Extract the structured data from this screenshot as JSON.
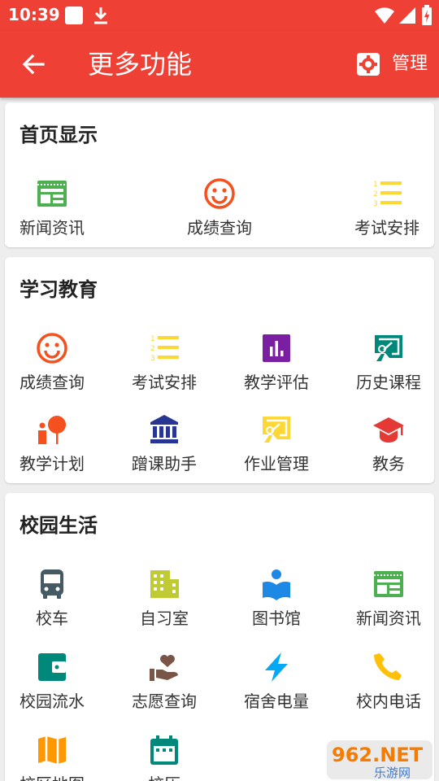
{
  "statusbar": {
    "time": "10:39"
  },
  "appbar": {
    "title": "更多功能",
    "manage_label": "管理"
  },
  "sections": [
    {
      "title": "首页显示",
      "items": [
        {
          "label": "新闻资讯",
          "icon": "newspaper-icon",
          "color": "#4caf50"
        },
        {
          "label": "成绩查询",
          "icon": "smiley-icon",
          "color": "#f4511e"
        },
        {
          "label": "考试安排",
          "icon": "numbered-list-icon",
          "color": "#fdd835"
        }
      ]
    },
    {
      "title": "学习教育",
      "items": [
        {
          "label": "成绩查询",
          "icon": "smiley-icon",
          "color": "#f4511e"
        },
        {
          "label": "考试安排",
          "icon": "numbered-list-icon",
          "color": "#fdd835"
        },
        {
          "label": "教学评估",
          "icon": "bar-chart-icon",
          "color": "#7b1fa2"
        },
        {
          "label": "历史课程",
          "icon": "chalkboard-icon",
          "color": "#00897b"
        },
        {
          "label": "教学计划",
          "icon": "teacher-icon",
          "color": "#f4511e"
        },
        {
          "label": "蹭课助手",
          "icon": "institution-icon",
          "color": "#283593"
        },
        {
          "label": "作业管理",
          "icon": "chalkboard-icon",
          "color": "#fdd835"
        },
        {
          "label": "教务",
          "icon": "graduation-cap-icon",
          "color": "#e53935"
        }
      ]
    },
    {
      "title": "校园生活",
      "items": [
        {
          "label": "校车",
          "icon": "bus-icon",
          "color": "#455a64"
        },
        {
          "label": "自习室",
          "icon": "building-icon",
          "color": "#c0ca33"
        },
        {
          "label": "图书馆",
          "icon": "reading-book-icon",
          "color": "#1e88e5"
        },
        {
          "label": "新闻资讯",
          "icon": "newspaper-icon",
          "color": "#4caf50"
        },
        {
          "label": "校园流水",
          "icon": "wallet-icon",
          "color": "#00897b"
        },
        {
          "label": "志愿查询",
          "icon": "volunteer-heart-icon",
          "color": "#795548"
        },
        {
          "label": "宿舍电量",
          "icon": "lightning-icon",
          "color": "#03a9f4"
        },
        {
          "label": "校内电话",
          "icon": "phone-icon",
          "color": "#ffc107"
        },
        {
          "label": "校区地图",
          "icon": "map-icon",
          "color": "#ff9800"
        },
        {
          "label": "校历",
          "icon": "calendar-icon",
          "color": "#00897b"
        }
      ]
    }
  ],
  "watermark": {
    "text": "962.NET",
    "subtext": "乐游网"
  }
}
